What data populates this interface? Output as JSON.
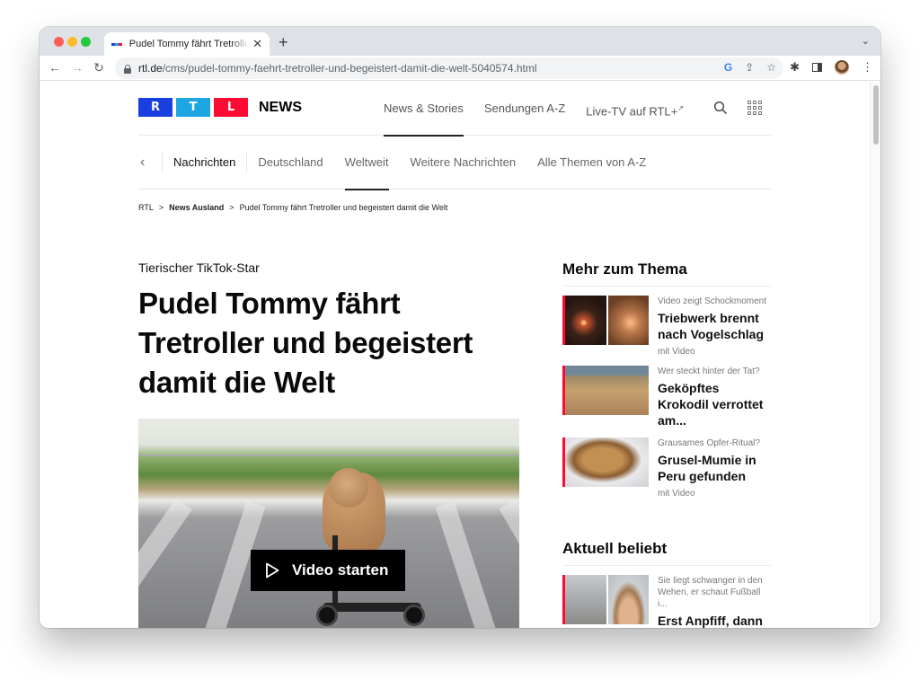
{
  "browser": {
    "tab": {
      "title": "Pudel Tommy fährt Tretroller und begeistert damit die Welt",
      "favicon_colors": [
        "#1a3fe0",
        "#1ea6e3",
        "#ff0a33"
      ]
    },
    "url": {
      "domain": "rtl.de",
      "path": "/cms/pudel-tommy-faehrt-tretroller-und-begeistert-damit-die-welt-5040574.html"
    },
    "icons": {
      "back": "←",
      "forward": "→",
      "reload": "↻",
      "new_tab": "+",
      "close_tab": "✕",
      "tab_menu": "⌄",
      "google": "G",
      "share": "⇪",
      "bookmark": "☆",
      "extensions": "✱",
      "menu": "⋮"
    }
  },
  "site": {
    "logo_letters": [
      "R",
      "T",
      "L"
    ],
    "logo_colors": [
      "#1a3fe0",
      "#1ea6e3",
      "#ff0a33"
    ],
    "logo_suffix": "NEWS",
    "main_nav": [
      {
        "label": "News & Stories",
        "active": true
      },
      {
        "label": "Sendungen A-Z",
        "active": false
      },
      {
        "label": "Live-TV auf RTL+",
        "active": false,
        "external_marker": "↗"
      }
    ],
    "sub_nav": {
      "back": "‹",
      "items": [
        {
          "label": "Nachrichten"
        },
        {
          "label": "Deutschland"
        },
        {
          "label": "Weltweit",
          "active": true
        },
        {
          "label": "Weitere Nachrichten"
        },
        {
          "label": "Alle Themen von A-Z"
        }
      ]
    },
    "breadcrumb": {
      "items": [
        "RTL",
        "News Ausland",
        "Pudel Tommy fährt Tretroller und begeistert damit die Welt"
      ],
      "separator": ">"
    }
  },
  "article": {
    "kicker": "Tierischer TikTok-Star",
    "headline": "Pudel Tommy fährt Tretroller und begeistert damit die Welt",
    "video_button": "Video starten"
  },
  "sidebar": {
    "more_title": "Mehr zum Thema",
    "more_items": [
      {
        "kicker": "Video zeigt Schockmoment",
        "title": "Triebwerk brennt nach Vogelschlag",
        "meta": "mit Video"
      },
      {
        "kicker": "Wer steckt hinter der Tat?",
        "title": "Geköpftes Krokodil verrottet am...",
        "meta": ""
      },
      {
        "kicker": "Grausames Opfer-Ritual?",
        "title": "Grusel-Mumie in Peru gefunden",
        "meta": "mit Video"
      }
    ],
    "popular_title": "Aktuell beliebt",
    "popular_items": [
      {
        "kicker": "Sie liegt schwanger in den Wehen, er schaut Fußball i...",
        "title": "Erst Anpfiff, dann Anschiss?"
      }
    ],
    "accent_color": "#ff0a33"
  }
}
